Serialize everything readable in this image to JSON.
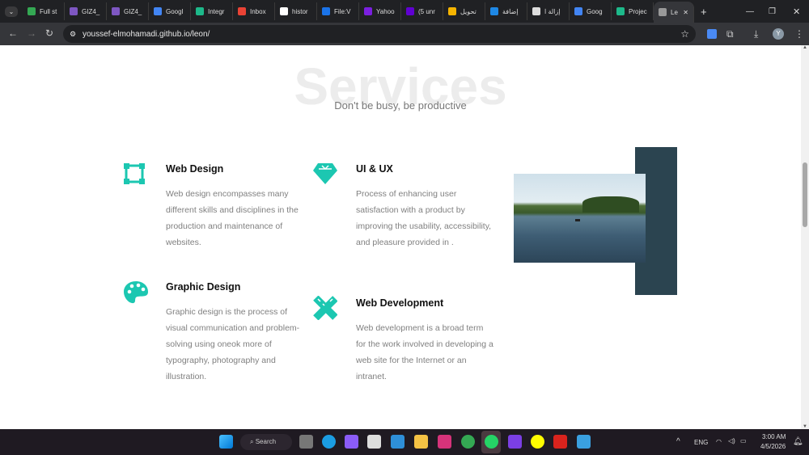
{
  "browser": {
    "tabs": [
      {
        "label": "Full st",
        "color": "#34a853"
      },
      {
        "label": "GIZ4_",
        "color": "#7e57c2"
      },
      {
        "label": "GIZ4_",
        "color": "#7e57c2"
      },
      {
        "label": "Googl",
        "color": "#4285f4"
      },
      {
        "label": "Integr",
        "color": "#1db98a"
      },
      {
        "label": "Inbox",
        "color": "#ea4335"
      },
      {
        "label": "histor",
        "color": "#ffffff"
      },
      {
        "label": "File:V",
        "color": "#1a73e8"
      },
      {
        "label": "Yahoo",
        "color": "#7b1fe0"
      },
      {
        "label": "(5 unr",
        "color": "#6001d2"
      },
      {
        "label": "تحويل",
        "color": "#f5b400"
      },
      {
        "label": "إضافة",
        "color": "#1e88e5"
      },
      {
        "label": "إزالة ا",
        "color": "#dddddd"
      },
      {
        "label": "Goog",
        "color": "#4285f4"
      },
      {
        "label": "Projec",
        "color": "#1db98a"
      },
      {
        "label": "Le",
        "color": "#999999"
      }
    ],
    "url": "youssef-elmohamadi.github.io/leon/",
    "profile_initial": "Y"
  },
  "page": {
    "title": "Services",
    "subtitle": "Don't be busy, be productive",
    "accent": "#1cc7b1",
    "services": [
      {
        "title": "Web Design",
        "text": "Web design encompasses many different skills and disciplines in the production and maintenance of websites.",
        "icon": "vector-square-icon"
      },
      {
        "title": "UI & UX",
        "text": "Process of enhancing user satisfaction with a product by improving the usability, accessibility, and pleasure provided in .",
        "icon": "diamond-icon"
      },
      {
        "title": "Graphic Design",
        "text": "Graphic design is the process of visual communication and problem-solving using oneok more of typography, photography and illustration.",
        "icon": "palette-icon"
      },
      {
        "title": "Web Development",
        "text": "Web development is a broad term for the work involved in developing a web site for the Internet or an intranet.",
        "icon": "pencil-ruler-icon"
      }
    ]
  },
  "taskbar": {
    "search": "Search",
    "lang": "ENG",
    "time": "3:00 AM",
    "date": "4/5/2026"
  }
}
